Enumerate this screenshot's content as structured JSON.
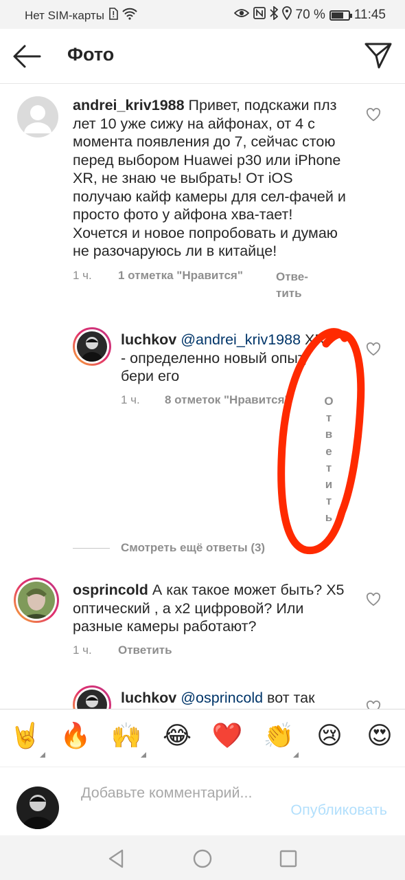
{
  "status_bar": {
    "carrier": "Нет SIM-карты",
    "battery": "70 %",
    "battery_level": 0.7,
    "time": "11:45"
  },
  "header": {
    "title": "Фото",
    "back_icon": "arrow-left-icon",
    "send_icon": "paper-plane-icon"
  },
  "comments": [
    {
      "username": "andrei_kriv1988",
      "text": "Привет, подскажи плз лет 10 уже сижу на айфонах, от 4 с момента появления до 7, сейчас стою перед выбором Huawei p30 или iPhone XR, не знаю че выбрать! От iOS получаю кайф камеры для сел-фачей и просто фото у айфона хва-тает! Хочется и новое попробовать и думаю не разочаруюсь ли в китайце!",
      "time": "1 ч.",
      "likes": "1 отметка \"Нравится\"",
      "reply": "Отве-тить"
    },
    {
      "username": "luchkov",
      "mention": "@andrei_kriv1988",
      "text": "XR - определенно новый опыт, бери его",
      "time": "1 ч.",
      "likes": "8 отметок \"Нравится\"",
      "reply": "Ответить"
    },
    {
      "username": "osprincold",
      "text": "А как такое может быть? X5 оптический , а x2 цифровой? Или разные камеры работают?",
      "time": "1 ч.",
      "reply": "Ответить"
    },
    {
      "username": "luchkov",
      "mention": "@osprincold",
      "text": "вот так"
    }
  ],
  "view_more": "Смотреть ещё ответы (3)",
  "emojis": [
    "🤘",
    "🔥",
    "🙌",
    "😂",
    "❤️",
    "👏",
    "😢",
    "😍"
  ],
  "composer": {
    "placeholder": "Добавьте комментарий...",
    "post_label": "Опубликовать"
  },
  "colors": {
    "annotation": "#ff2a00",
    "mention": "#003569",
    "post_disabled": "#b2dffc"
  }
}
